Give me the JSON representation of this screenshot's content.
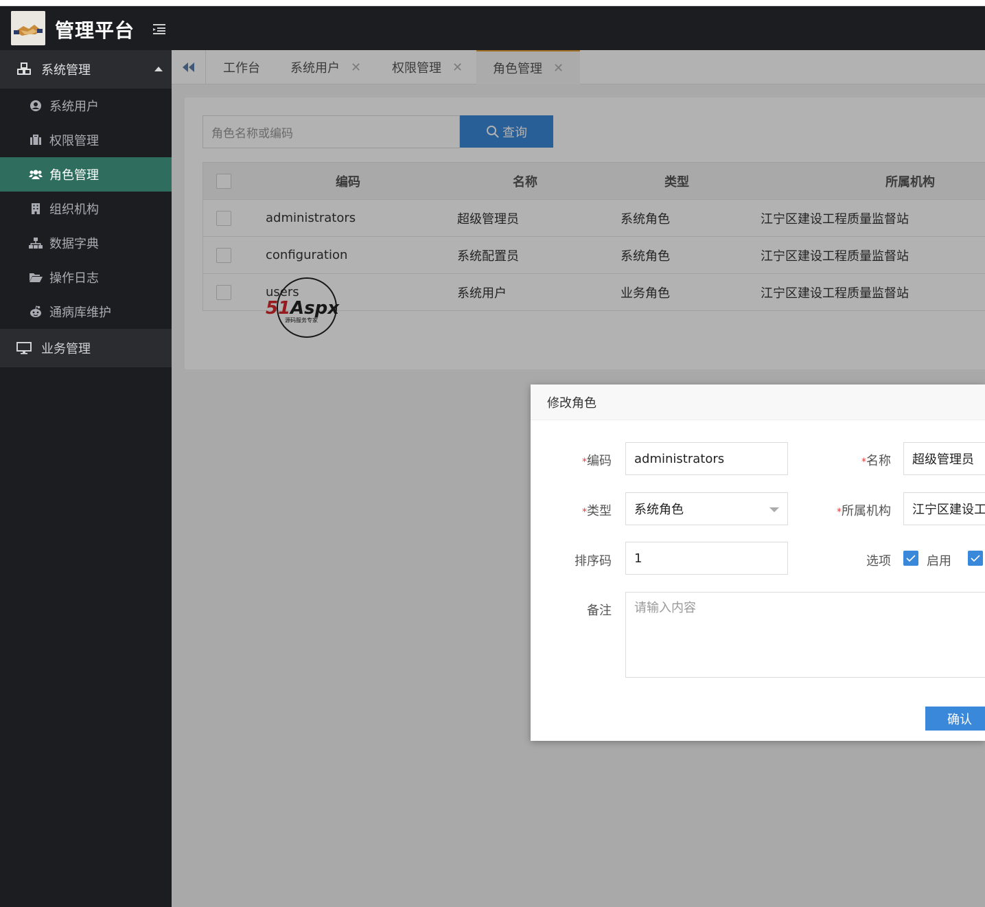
{
  "header": {
    "title": "管理平台"
  },
  "sidebar": {
    "group_system": "系统管理",
    "items": [
      {
        "label": "系统用户",
        "icon": "user-circle-icon"
      },
      {
        "label": "权限管理",
        "icon": "briefcase-icon"
      },
      {
        "label": "角色管理",
        "icon": "users-icon"
      },
      {
        "label": "组织机构",
        "icon": "building-icon"
      },
      {
        "label": "数据字典",
        "icon": "sitemap-icon"
      },
      {
        "label": "操作日志",
        "icon": "folder-open-icon"
      },
      {
        "label": "通病库维护",
        "icon": "reddit-icon"
      }
    ],
    "group_business": "业务管理"
  },
  "tabs": [
    {
      "label": "工作台"
    },
    {
      "label": "系统用户"
    },
    {
      "label": "权限管理"
    },
    {
      "label": "角色管理"
    }
  ],
  "search": {
    "placeholder": "角色名称或编码",
    "button": "查询"
  },
  "table": {
    "headers": [
      "编码",
      "名称",
      "类型",
      "所属机构"
    ],
    "rows": [
      [
        "administrators",
        "超级管理员",
        "系统角色",
        "江宁区建设工程质量监督站"
      ],
      [
        "configuration",
        "系统配置员",
        "系统角色",
        "江宁区建设工程质量监督站"
      ],
      [
        "users",
        "系统用户",
        "业务角色",
        "江宁区建设工程质量监督站"
      ]
    ]
  },
  "watermark": {
    "brand": "51Aspx",
    "slogan": "源码服务专家"
  },
  "modal": {
    "title": "修改角色",
    "required_mark": "*",
    "labels": {
      "code": "编码",
      "name": "名称",
      "type": "类型",
      "org": "所属机构",
      "sort": "排序码",
      "options": "选项",
      "remark": "备注"
    },
    "values": {
      "code": "administrators",
      "name": "超级管理员",
      "type": "系统角色",
      "org": "江宁区建设工",
      "sort": "1"
    },
    "option_enable": "启用",
    "remark_placeholder": "请输入内容",
    "confirm": "确认"
  },
  "colors": {
    "accent": "#3a88d9",
    "active_menu": "#2f6e5e",
    "tab_active_border": "#e8a33a",
    "sidebar_bg": "#1b1d20"
  }
}
